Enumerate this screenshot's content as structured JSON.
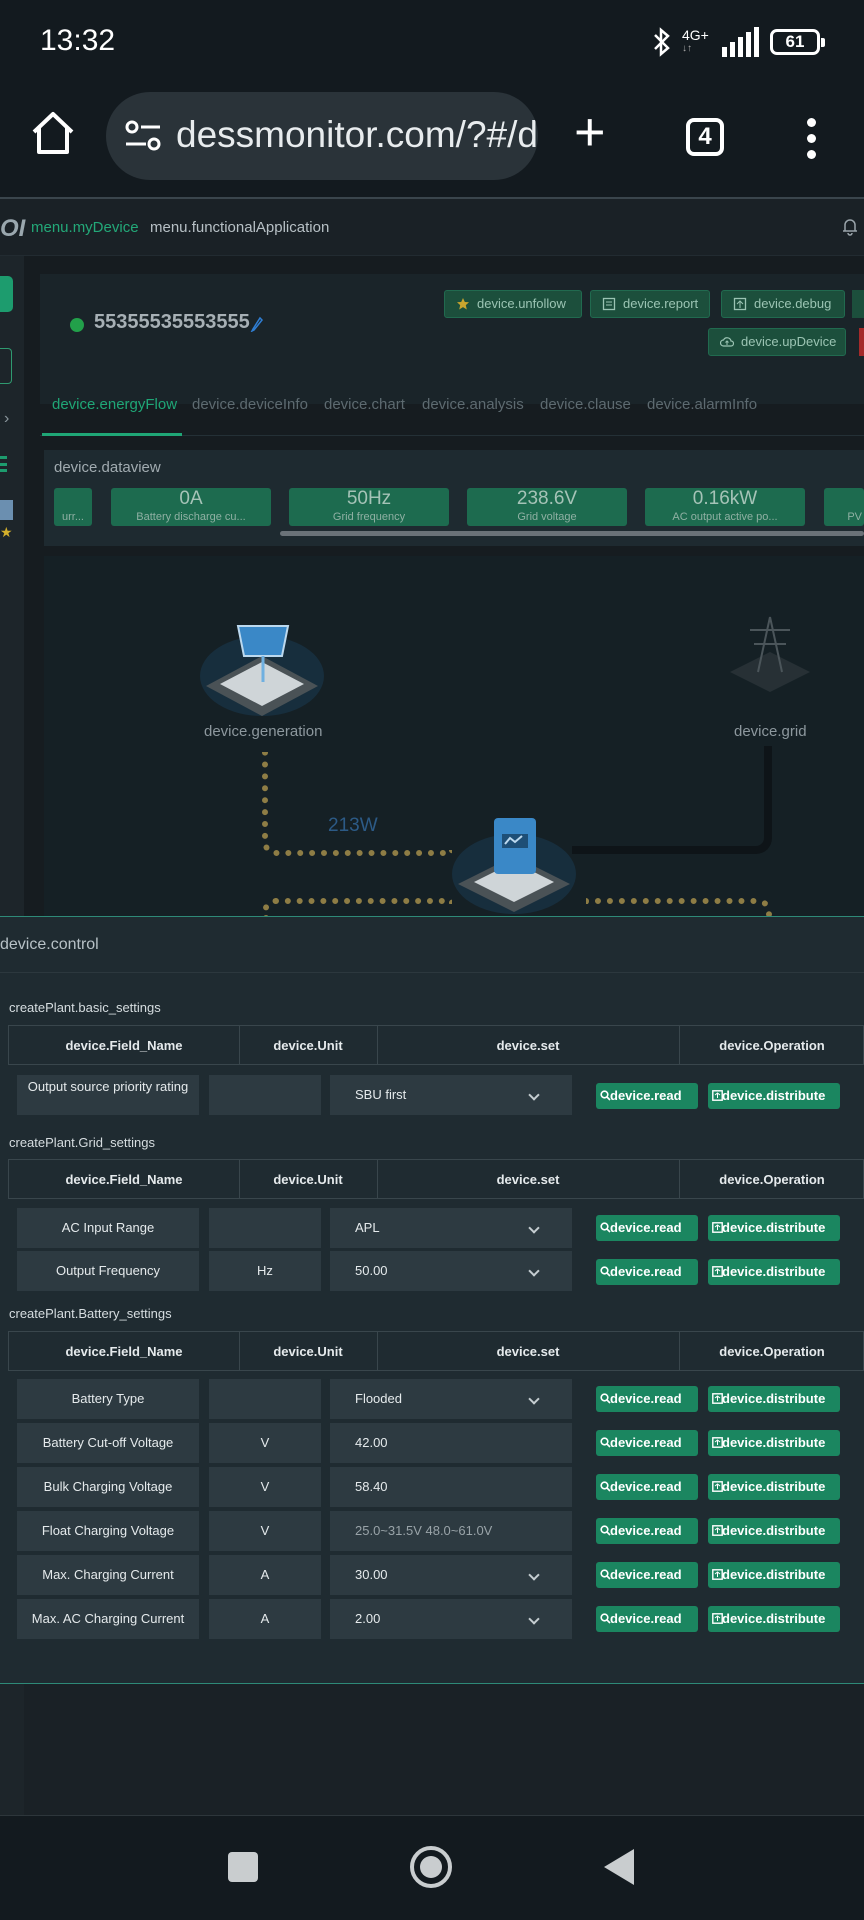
{
  "status_bar": {
    "time": "13:32",
    "network_top": "4G+",
    "network_bottom": "↓↑",
    "battery": "61"
  },
  "browser": {
    "url": "dessmonitor.com/?#/d",
    "tabs_count": "4"
  },
  "app_header": {
    "logo": "OI",
    "menu_my_device": "menu.myDevice",
    "menu_functional": "menu.functionalApplication"
  },
  "device": {
    "id": "55355535553555",
    "buttons": {
      "unfollow": "device.unfollow",
      "report": "device.report",
      "debug": "device.debug",
      "up_device": "device.upDevice"
    },
    "tabs": [
      "device.energyFlow",
      "device.deviceInfo",
      "device.chart",
      "device.analysis",
      "device.clause",
      "device.alarmInfo"
    ]
  },
  "dataview": {
    "title": "device.dataview",
    "partial_left_label": "urr...",
    "partial_right_label": "PV",
    "cards": [
      {
        "value": "0A",
        "label": "Battery discharge cu..."
      },
      {
        "value": "50Hz",
        "label": "Grid frequency"
      },
      {
        "value": "238.6V",
        "label": "Grid voltage"
      },
      {
        "value": "0.16kW",
        "label": "AC output active po..."
      }
    ]
  },
  "energy_flow": {
    "generation_label": "device.generation",
    "grid_label": "device.grid",
    "pv_power": "213W"
  },
  "control": {
    "title": "device.control",
    "headers": {
      "field_name": "device.Field_Name",
      "unit": "device.Unit",
      "set": "device.set",
      "operation": "device.Operation"
    },
    "read_label": "device.read",
    "distribute_label": "device.distribute",
    "sections": [
      {
        "title": "createPlant.basic_settings",
        "rows": [
          {
            "field": "Output source priority rating",
            "unit": "",
            "value": "SBU first",
            "type": "select"
          }
        ]
      },
      {
        "title": "createPlant.Grid_settings",
        "rows": [
          {
            "field": "AC Input Range",
            "unit": "",
            "value": "APL",
            "type": "select"
          },
          {
            "field": "Output Frequency",
            "unit": "Hz",
            "value": "50.00",
            "type": "select"
          }
        ]
      },
      {
        "title": "createPlant.Battery_settings",
        "rows": [
          {
            "field": "Battery Type",
            "unit": "",
            "value": "Flooded",
            "type": "select"
          },
          {
            "field": "Battery Cut-off Voltage",
            "unit": "V",
            "value": "42.00",
            "type": "input"
          },
          {
            "field": "Bulk Charging Voltage",
            "unit": "V",
            "value": "58.40",
            "type": "input"
          },
          {
            "field": "Float Charging Voltage",
            "unit": "V",
            "placeholder": "25.0~31.5V 48.0~61.0V",
            "type": "input"
          },
          {
            "field": "Max. Charging Current",
            "unit": "A",
            "value": "30.00",
            "type": "select"
          },
          {
            "field": "Max. AC Charging Current",
            "unit": "A",
            "value": "2.00",
            "type": "select"
          }
        ]
      }
    ]
  }
}
